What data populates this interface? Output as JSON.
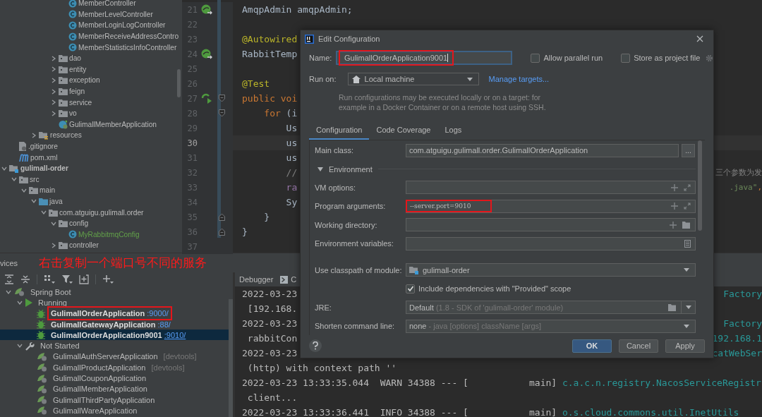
{
  "project_tree": [
    {
      "children": [
        {
          "children": [
            {
              "children": [
                {
                  "children": [
                    {
                      "children": [
                        {
                          "children": [
                            {
                              "label": "MemberController",
                              "kind": "class"
                            },
                            {
                              "label": "MemberLevelController",
                              "kind": "class"
                            },
                            {
                              "label": "MemberLoginLogController",
                              "kind": "class"
                            },
                            {
                              "label": "MemberReceiveAddressContro",
                              "kind": "class"
                            },
                            {
                              "label": "MemberStatisticsInfoController",
                              "kind": "class"
                            }
                          ]
                        },
                        {
                          "label": "dao",
                          "kind": "folder",
                          "expanded": false
                        },
                        {
                          "label": "entity",
                          "kind": "folder",
                          "expanded": false
                        },
                        {
                          "label": "exception",
                          "kind": "folder",
                          "expanded": false
                        },
                        {
                          "label": "feign",
                          "kind": "folder",
                          "expanded": false
                        },
                        {
                          "label": "service",
                          "kind": "folder",
                          "expanded": false
                        },
                        {
                          "label": "vo",
                          "kind": "folder",
                          "expanded": false
                        },
                        {
                          "label": "GulimallMemberApplication",
                          "kind": "app"
                        }
                      ]
                    }
                  ]
                },
                {
                  "label": "resources",
                  "kind": "resources",
                  "expanded": false
                }
              ]
            }
          ]
        },
        {
          "label": ".gitignore",
          "kind": "file"
        },
        {
          "label": "pom.xml",
          "kind": "maven"
        }
      ]
    },
    {
      "label": "gulimall-order",
      "kind": "module",
      "expanded": true,
      "children": [
        {
          "label": "src",
          "kind": "folder",
          "expanded": true,
          "children": [
            {
              "label": "main",
              "kind": "folder",
              "expanded": true,
              "children": [
                {
                  "label": "java",
                  "kind": "source",
                  "expanded": true,
                  "children": [
                    {
                      "label": "com.atguigu.gulimall.order",
                      "kind": "folder",
                      "expanded": true,
                      "children": [
                        {
                          "label": "config",
                          "kind": "folder",
                          "expanded": true,
                          "children": [
                            {
                              "label": "MyRabbitmqConfig",
                              "kind": "class",
                              "added": true
                            }
                          ]
                        },
                        {
                          "label": "controller",
                          "kind": "folder",
                          "expanded": false
                        }
                      ]
                    }
                  ]
                }
              ]
            }
          ]
        }
      ]
    }
  ],
  "editor": {
    "lines": [
      {
        "number": "21",
        "gutter_icon": {
          "kind": "bean"
        },
        "current": false,
        "code": [
          {
            "text": "AmqpAdmin amqpAdmin;",
            "kind": "plain"
          }
        ]
      },
      {
        "number": "22",
        "current": false
      },
      {
        "number": "23",
        "current": false,
        "code": [
          {
            "text": "@Autowired",
            "kind": "annotation"
          }
        ]
      },
      {
        "number": "24",
        "gutter_icon": {
          "kind": "bean"
        },
        "current": false,
        "code": [
          {
            "text": "RabbitTemp",
            "kind": "plain"
          }
        ]
      },
      {
        "number": "25",
        "current": false
      },
      {
        "number": "26",
        "current": false,
        "code": [
          {
            "text": "@Test",
            "kind": "annotation"
          }
        ]
      },
      {
        "number": "27",
        "gutter_icon": {
          "kind": "run"
        },
        "fold_marker": {
          "kind": "start"
        },
        "current": false,
        "code": [
          {
            "text": "public voi",
            "kind": "keyword"
          }
        ]
      },
      {
        "number": "28",
        "fold_marker": {
          "kind": "start"
        },
        "current": false,
        "code": [
          {
            "text": "    for",
            "kind": "keyword"
          },
          {
            "text": " (i",
            "kind": "plain"
          }
        ]
      },
      {
        "number": "29",
        "current": false,
        "code": [
          {
            "text": "        Us",
            "kind": "plain"
          }
        ]
      },
      {
        "number": "30",
        "current": true,
        "code": [
          {
            "text": "        us",
            "kind": "plain"
          }
        ]
      },
      {
        "number": "31",
        "current": false,
        "code": [
          {
            "text": "        us",
            "kind": "plain"
          }
        ]
      },
      {
        "number": "32",
        "current": false,
        "code": [
          {
            "text": "        //",
            "kind": "comment"
          }
        ],
        "tail": [
          {
            "text": "三个参数为发",
            "kind": "comment"
          }
        ]
      },
      {
        "number": "33",
        "current": false,
        "code": [
          {
            "text": "        ra",
            "kind": "field"
          }
        ],
        "tail": [
          {
            "text": ".java\"",
            "kind": "string"
          },
          {
            "text": ",",
            "kind": "keyword"
          }
        ]
      },
      {
        "number": "34",
        "current": false,
        "code": [
          {
            "text": "        Sy",
            "kind": "plain"
          }
        ]
      },
      {
        "number": "35",
        "fold_marker": {
          "kind": "end"
        },
        "current": false,
        "code": [
          {
            "text": "    }",
            "kind": "plain"
          }
        ]
      },
      {
        "number": "36",
        "fold_marker": {
          "kind": "end"
        },
        "current": false,
        "code": [
          {
            "text": "}",
            "kind": "plain"
          }
        ]
      },
      {
        "number": "37",
        "current": false
      }
    ]
  },
  "services": {
    "title": "vices",
    "annotation": "右击复制一个端口号不同的服务",
    "tree": [
      {
        "label": "Spring Boot",
        "kind": "group",
        "expanded": true,
        "selected": false,
        "children": [
          {
            "label": "Running",
            "kind": "running",
            "expanded": true,
            "selected": false,
            "children": [
              {
                "label": "GulimallOrderApplication",
                "kind": "running_app",
                "port": ":9000/",
                "selected": false,
                "highlighted": true
              },
              {
                "label": "GulimallGatewayApplication",
                "kind": "running_app",
                "port": ":88/",
                "selected": false,
                "highlighted": false
              },
              {
                "label": "GulimallOrderApplication9001",
                "kind": "running_app",
                "port": ":9010/",
                "selected": true,
                "highlighted": false
              }
            ]
          },
          {
            "label": "Not Started",
            "kind": "stopped",
            "expanded": true,
            "selected": false,
            "children": [
              {
                "label": "GulimallAuthServerApplication",
                "kind": "app",
                "tag": "[devtools]",
                "selected": false
              },
              {
                "label": "GulimallProductApplication",
                "kind": "app",
                "tag": "[devtools]",
                "selected": false
              },
              {
                "label": "GulimallCouponApplication",
                "kind": "app",
                "selected": false
              },
              {
                "label": "GulimallMemberApplication",
                "kind": "app",
                "selected": false
              },
              {
                "label": "GulimallThirdPartyApplication",
                "kind": "app",
                "selected": false
              },
              {
                "label": "GulimallWareApplication",
                "kind": "app",
                "selected": false
              }
            ]
          }
        ]
      }
    ]
  },
  "console": {
    "tabs": [
      {
        "label": "Debugger",
        "selected": false
      },
      {
        "label": "C",
        "selected": false
      }
    ],
    "lines": [
      {
        "text": "2022-03-23",
        "tail": "Factory"
      },
      {
        "text": " [192.168."
      },
      {
        "text": "2022-03-23",
        "tail": "Factory"
      },
      {
        "text": " rabbitCon",
        "tail": "192.168.1"
      },
      {
        "text": "2022-03-23",
        "tail": "catWebSer"
      },
      {
        "text": " (http) with context path ''"
      },
      {
        "text": "2022-03-23 13:33:35.044  WARN 34388 --- [           main] ",
        "logger": "c.a.c.n.registry.NacosServiceRegistr"
      },
      {
        "text": " client..."
      },
      {
        "text": "2022-03-23 13:33:36.441  INFO 34388 --- [           main] ",
        "logger": "o.s.cloud.commons.util.InetUtils"
      }
    ]
  },
  "dialog": {
    "title": "Edit Configuration",
    "name": {
      "label": "Name:",
      "value": "GulimallOrderApplication9001",
      "highlighted": true
    },
    "allow_parallel_run": {
      "label": "Allow parallel run",
      "checked": false
    },
    "store_as_project_file": {
      "label": "Store as project file",
      "checked": false
    },
    "run_on": {
      "label": "Run on:",
      "value": "Local machine",
      "link": "Manage targets..."
    },
    "hint": "Run configurations may be executed locally or on a target: for example in a Docker Container or on a remote host using SSH.",
    "tabs": [
      {
        "label": "Configuration",
        "selected": true
      },
      {
        "label": "Code Coverage",
        "selected": false
      },
      {
        "label": "Logs",
        "selected": false
      }
    ],
    "main_class": {
      "label": "Main class:",
      "value": "com.atguigu.gulimall.order.GulimallOrderApplication",
      "button": "..."
    },
    "environment": {
      "label": "Environment",
      "expanded": true
    },
    "fields": [
      {
        "label": "VM options:",
        "kind": "expandable",
        "highlighted": false
      },
      {
        "label": "Program arguments:",
        "value": "--server.port=9010",
        "kind": "expandable",
        "highlighted": true
      },
      {
        "label": "Working directory:",
        "kind": "folder",
        "highlighted": false
      },
      {
        "label": "Environment variables:",
        "kind": "document",
        "highlighted": false
      }
    ],
    "module": {
      "label": "Use classpath of module:",
      "value": "gulimall-order"
    },
    "include_provided": {
      "label": "Include dependencies with \"Provided\" scope",
      "checked": true
    },
    "jre": {
      "label": "JRE:",
      "value": "Default",
      "detail": "(1.8 - SDK of 'gulimall-order' module)"
    },
    "shorten": {
      "label": "Shorten command line:",
      "value": "none",
      "detail": "- java [options] className [args]"
    },
    "buttons": [
      {
        "label": "OK",
        "kind": "primary"
      },
      {
        "label": "Cancel",
        "kind": "normal"
      },
      {
        "label": "Apply",
        "kind": "normal"
      }
    ]
  }
}
